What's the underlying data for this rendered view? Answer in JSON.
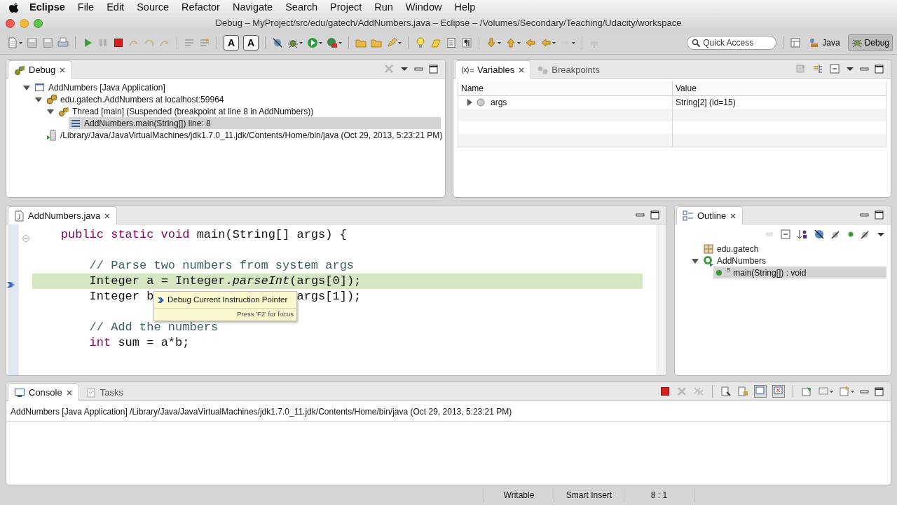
{
  "menu_bar": {
    "items": [
      {
        "label": "Eclipse",
        "kind": "app"
      },
      {
        "label": "File",
        "kind": "menu"
      },
      {
        "label": "Edit",
        "kind": "menu"
      },
      {
        "label": "Source",
        "kind": "menu"
      },
      {
        "label": "Refactor",
        "kind": "menu"
      },
      {
        "label": "Navigate",
        "kind": "menu"
      },
      {
        "label": "Search",
        "kind": "menu"
      },
      {
        "label": "Project",
        "kind": "menu"
      },
      {
        "label": "Run",
        "kind": "menu"
      },
      {
        "label": "Window",
        "kind": "menu"
      },
      {
        "label": "Help",
        "kind": "menu"
      }
    ]
  },
  "window": {
    "title": "Debug – MyProject/src/edu/gatech/AddNumbers.java – Eclipse – /Volumes/Secondary/Teaching/Udacity/workspace"
  },
  "toolbar": {
    "toggles": [
      {
        "glyph": "A",
        "on": true
      },
      {
        "glyph": "A",
        "on": true
      }
    ],
    "quick_access": {
      "placeholder": "Quick Access"
    },
    "perspectives": [
      {
        "label": "Java",
        "selected": false
      },
      {
        "label": "Debug",
        "selected": true
      }
    ]
  },
  "debug_view": {
    "tabs": [
      {
        "label": "Debug",
        "selected": true
      }
    ],
    "tree": [
      {
        "label": "AddNumbers [Java Application]",
        "kind": "launch",
        "expanded": true,
        "selected": false,
        "children": [
          {
            "label": "edu.gatech.AddNumbers at localhost:59964",
            "kind": "target",
            "expanded": true,
            "selected": false,
            "children": [
              {
                "label": "Thread [main] (Suspended (breakpoint at line 8 in AddNumbers))",
                "kind": "thread",
                "expanded": true,
                "selected": false,
                "children": [
                  {
                    "label": "AddNumbers.main(String[]) line: 8",
                    "kind": "frame",
                    "selected": true
                  }
                ]
              }
            ]
          },
          {
            "label": "/Library/Java/JavaVirtualMachines/jdk1.7.0_11.jdk/Contents/Home/bin/java (Oct 29, 2013, 5:23:21 PM)",
            "kind": "process",
            "selected": false
          }
        ]
      }
    ]
  },
  "variables_view": {
    "tabs": [
      {
        "label": "Variables",
        "selected": true
      },
      {
        "label": "Breakpoints",
        "selected": false
      }
    ],
    "columns": [
      "Name",
      "Value"
    ],
    "rows": [
      {
        "name": "args",
        "value": "String[2]  (id=15)",
        "expanded": false
      }
    ]
  },
  "editor": {
    "tabs": [
      {
        "label": "AddNumbers.java",
        "selected": true
      }
    ],
    "lines": [
      {
        "kind": "code",
        "current": false,
        "segments": [
          {
            "kind": "keyword",
            "text": "public static void"
          },
          {
            "kind": "code",
            "text": " main(String[] args) {"
          }
        ],
        "children": [
          {
            "kind": "blank"
          },
          {
            "kind": "code",
            "current": false,
            "segments": [
              {
                "kind": "comment",
                "text": "// Parse two numbers from system args"
              }
            ]
          },
          {
            "kind": "code",
            "current": true,
            "segments": [
              {
                "kind": "code",
                "text": "Integer a = Integer."
              },
              {
                "kind": "italic",
                "text": "parseInt"
              },
              {
                "kind": "code",
                "text": "(args[0]);"
              }
            ]
          },
          {
            "kind": "code",
            "current": false,
            "segments": [
              {
                "kind": "code",
                "text": "Integer b"
              },
              {
                "kind": "gap"
              },
              {
                "kind": "code",
                "text": "args[1]);"
              }
            ]
          },
          {
            "kind": "blank"
          },
          {
            "kind": "code",
            "current": false,
            "segments": [
              {
                "kind": "comment",
                "text": "// Add the numbers"
              }
            ]
          },
          {
            "kind": "code",
            "current": false,
            "segments": [
              {
                "kind": "keyword",
                "text": "int"
              },
              {
                "kind": "code",
                "text": " sum = a*b;"
              }
            ]
          }
        ]
      }
    ],
    "tooltip": {
      "title": "Debug Current Instruction Pointer",
      "hint": "Press 'F2' for focus"
    }
  },
  "outline_view": {
    "tabs": [
      {
        "label": "Outline",
        "selected": true
      }
    ],
    "tree": [
      {
        "label": "edu.gatech",
        "kind": "package",
        "selected": false
      },
      {
        "label": "AddNumbers",
        "kind": "class",
        "expanded": true,
        "selected": false,
        "children": [
          {
            "label": "main(String[]) : void",
            "kind": "method",
            "modifier": "S",
            "selected": true
          }
        ]
      }
    ]
  },
  "console_view": {
    "tabs": [
      {
        "label": "Console",
        "selected": true
      },
      {
        "label": "Tasks",
        "selected": false
      }
    ],
    "description": "AddNumbers [Java Application] /Library/Java/JavaVirtualMachines/jdk1.7.0_11.jdk/Contents/Home/bin/java (Oct 29, 2013, 5:23:21 PM)"
  },
  "status_bar": [
    "Writable",
    "Smart Insert",
    "8 : 1"
  ]
}
